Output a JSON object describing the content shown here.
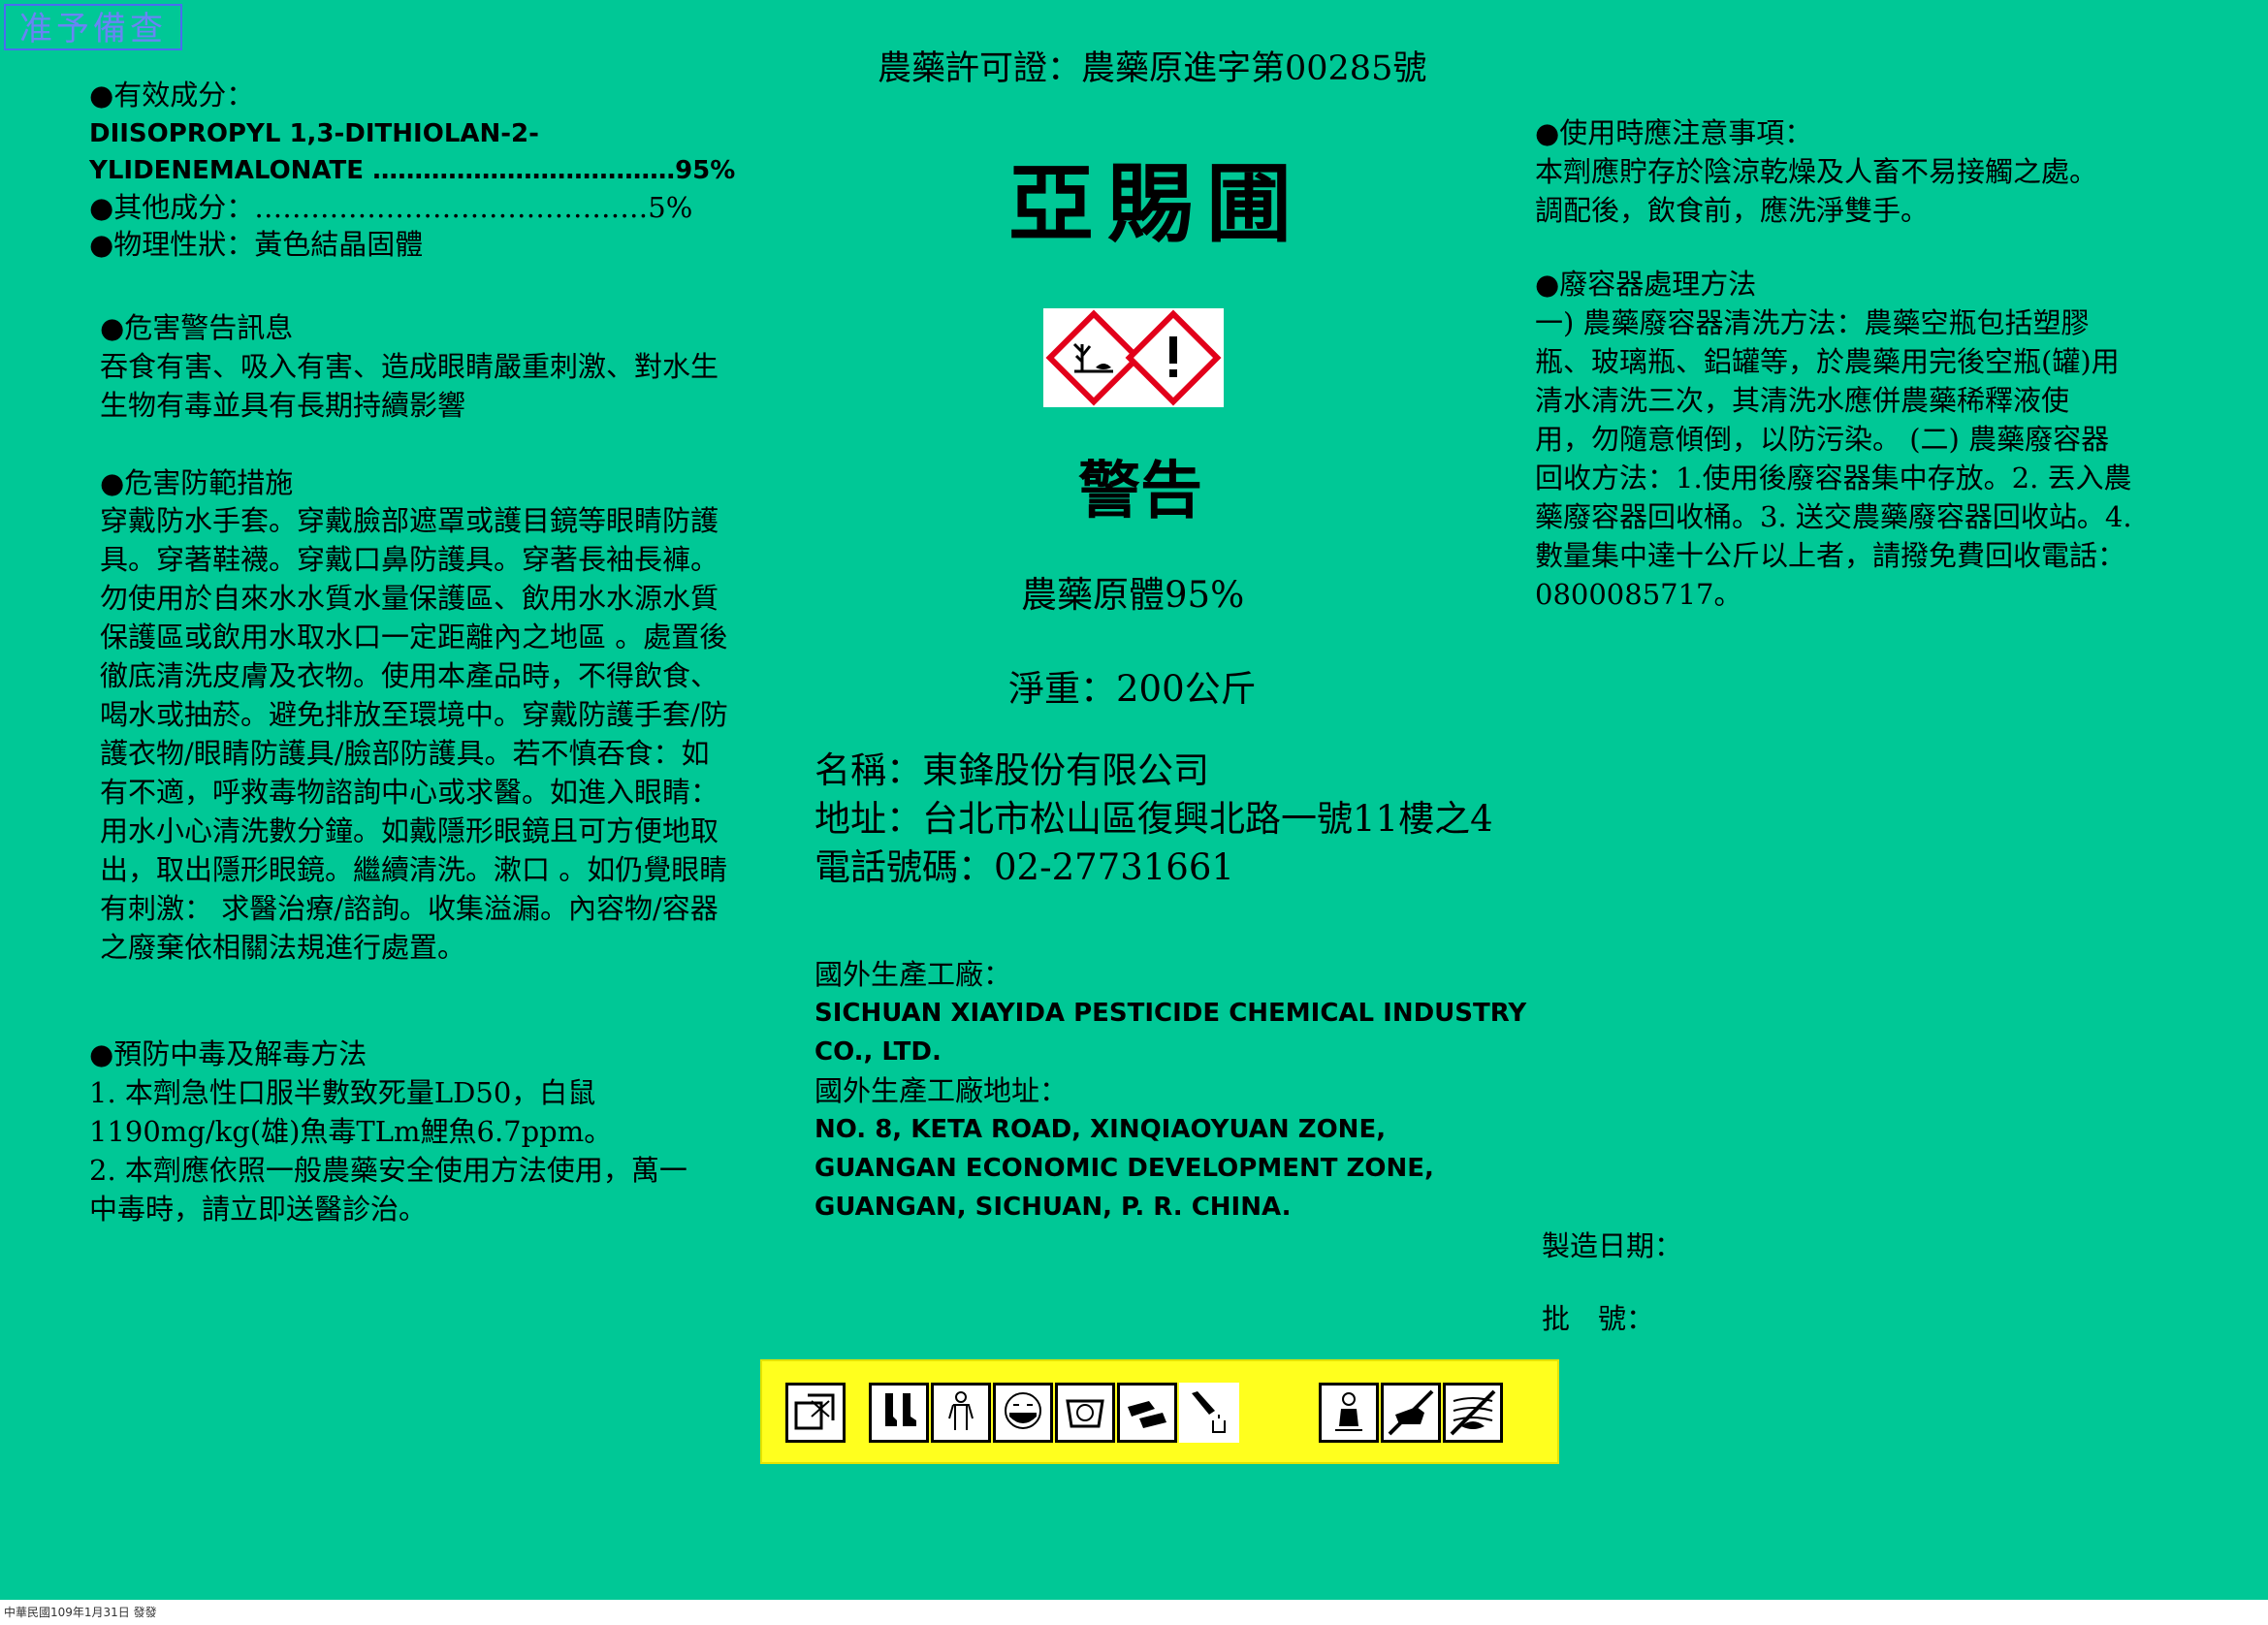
{
  "stamp": "准予備查",
  "left": {
    "active_ingredient_heading": "●有效成分：",
    "active_ingredient_name_1": "DIISOPROPYL 1,3-DITHIOLAN-2-",
    "active_ingredient_name_2": "YLIDENEMALONATE ………………………………95%",
    "other_ingredients": "●其他成分：……………………………………5%",
    "physical_state": "●物理性狀：黃色結晶固體",
    "hazard_heading": "●危害警告訊息",
    "hazard_lines": [
      "吞食有害、吸入有害、造成眼睛嚴重刺激、對水生",
      "生物有毒並具有長期持續影響"
    ],
    "precaution_heading": "●危害防範措施",
    "precaution_lines": [
      "穿戴防水手套。穿戴臉部遮罩或護目鏡等眼睛防護",
      "具。穿著鞋襪。穿戴口鼻防護具。穿著長袖長褲。",
      "勿使用於自來水水質水量保護區、飲用水水源水質",
      "保護區或飲用水取水口一定距離內之地區 。處置後",
      "徹底清洗皮膚及衣物。使用本產品時，不得飲食、",
      "喝水或抽菸。避免排放至環境中。穿戴防護手套/防",
      "護衣物/眼睛防護具/臉部防護具。若不慎吞食：如",
      "有不適，呼救毒物諮詢中心或求醫。如進入眼睛：",
      "用水小心清洗數分鐘。如戴隱形眼鏡且可方便地取",
      "出，取出隱形眼鏡。繼續清洗。漱口 。如仍覺眼睛",
      "有刺激： 求醫治療/諮詢。收集溢漏。內容物/容器",
      "之廢棄依相關法規進行處置。"
    ],
    "antidote_heading": "●預防中毒及解毒方法",
    "antidote_lines": [
      "1. 本劑急性口服半數致死量LD50，白鼠",
      "1190mg/kg(雄)魚毒TLm鯉魚6.7ppm。",
      "2. 本劑應依照一般農藥安全使用方法使用，萬一",
      "中毒時，請立即送醫診治。"
    ]
  },
  "center": {
    "permit": "農藥許可證：農藥原進字第00285號",
    "product_name": "亞賜圃",
    "signal_word": "警告",
    "formulation": "農藥原體95%",
    "net_weight": "淨重：200公斤",
    "company_name": "名稱：東鋒股份有限公司",
    "company_address": "地址：台北市松山區復興北路一號11樓之4",
    "company_phone": "電話號碼：02-27731661",
    "factory_heading": "國外生產工廠：",
    "factory_name_1": "SICHUAN XIAYIDA PESTICIDE CHEMICAL INDUSTRY",
    "factory_name_2": "CO., LTD.",
    "factory_address_heading": "國外生產工廠地址：",
    "factory_address_1": "NO. 8, KETA ROAD, XINQIAOYUAN ZONE,",
    "factory_address_2": "GUANGAN ECONOMIC DEVELOPMENT ZONE,",
    "factory_address_3": "GUANGAN, SICHUAN, P. R. CHINA."
  },
  "right": {
    "notice_heading": "●使用時應注意事項：",
    "notice_lines": [
      "本劑應貯存於陰涼乾燥及人畜不易接觸之處。",
      "調配後，飲食前，應洗淨雙手。"
    ],
    "disposal_heading": "●廢容器處理方法",
    "disposal_lines": [
      "一) 農藥廢容器清洗方法：農藥空瓶包括塑膠",
      "瓶、玻璃瓶、鋁罐等，於農藥用完後空瓶(罐)用",
      "清水清洗三次，其清洗水應併農藥稀釋液使",
      "用，勿隨意傾倒，以防污染。 (二) 農藥廢容器",
      "回收方法：1.使用後廢容器集中存放。2. 丟入農",
      "藥廢容器回收桶。3. 送交農藥廢容器回收站。4.",
      "數量集中達十公斤以上者，請撥免費回收電話：",
      "0800085717。"
    ],
    "manufacture_date_label": "製造日期：",
    "batch_label": "批　號："
  },
  "pictograms": [
    "storage-icon",
    "boots-icon",
    "coverall-icon",
    "mask-icon",
    "face-shield-icon",
    "gloves-icon",
    "wash-icon",
    "livestock-warning-icon",
    "no-animal-icon",
    "no-fish-icon"
  ],
  "footer": "中華民國109年1月31日 發發",
  "colors": {
    "background": "#00c896",
    "pictogram_bar": "#ffff1e",
    "ghs_red": "#e2001a"
  }
}
